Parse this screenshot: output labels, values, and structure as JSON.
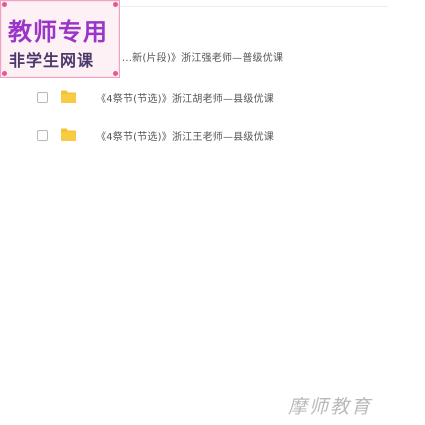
{
  "stamp": {
    "title": "教师专用",
    "subtitle": "非学生网课"
  },
  "rows": [
    {
      "label": "...新(片段)》浙江强老师—普级优课"
    },
    {
      "label": "《4祭节(节选)》浙江胡老师—县级优课"
    },
    {
      "label": "《4祭节(节选)》浙江王老师—县级优课"
    }
  ],
  "watermark": "摩师教育",
  "colors": {
    "folder": "#f5c232",
    "stamp_title": "#9b35c8",
    "stamp_border": "#f2a3c2"
  }
}
